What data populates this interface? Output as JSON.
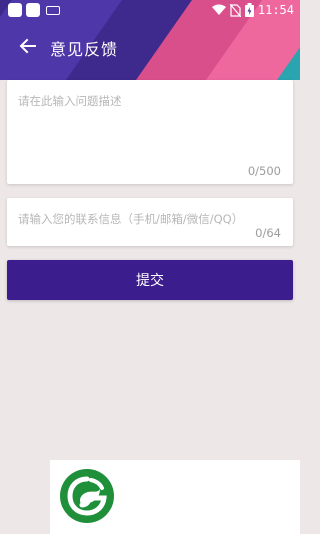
{
  "status_bar": {
    "time": "11:54",
    "icons": [
      "app-icon",
      "app-icon",
      "keyboard-icon",
      "wifi-icon",
      "no-sim-icon",
      "battery-icon"
    ]
  },
  "app_bar": {
    "title": "意见反馈",
    "back_icon": "back-arrow-icon"
  },
  "form": {
    "description": {
      "placeholder": "请在此输入问题描述",
      "counter": "0/500"
    },
    "contact": {
      "placeholder": "请输入您的联系信息（手机/邮箱/微信/QQ）",
      "counter": "0/64"
    },
    "submit_label": "提交"
  },
  "colors": {
    "header_purple": "#3e2a8c",
    "submit_purple": "#3c1d8e",
    "accent_pink": "#d94f8c",
    "accent_teal": "#2aa5b0",
    "logo_green": "#1f8f3a"
  }
}
